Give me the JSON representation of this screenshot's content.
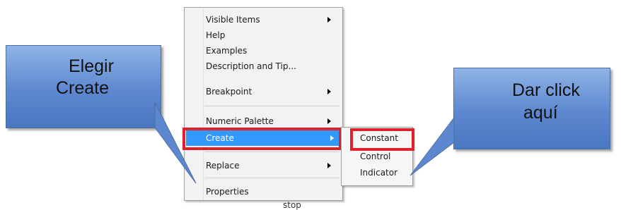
{
  "context_menu": {
    "items": [
      {
        "label": "Visible Items",
        "submenu": true
      },
      {
        "label": "Help",
        "submenu": false
      },
      {
        "label": "Examples",
        "submenu": false
      },
      {
        "label": "Description and Tip...",
        "submenu": false
      },
      {
        "label": "Breakpoint",
        "submenu": true
      },
      {
        "label": "Numeric Palette",
        "submenu": true
      },
      {
        "label": "Create",
        "submenu": true,
        "highlighted": true
      },
      {
        "label": "Replace",
        "submenu": true
      },
      {
        "label": "Properties",
        "submenu": false
      }
    ]
  },
  "submenu": {
    "items": [
      "Constant",
      "Control",
      "Indicator"
    ]
  },
  "background_text": "stop",
  "callouts": {
    "left": {
      "line1": "Elegir",
      "line2": "Create"
    },
    "right": {
      "line1": "Dar click",
      "line2": "aquí"
    }
  },
  "colors": {
    "highlight": "#3399ff",
    "annotation_red": "#e0202a",
    "callout_blue": "#5d88cf"
  }
}
